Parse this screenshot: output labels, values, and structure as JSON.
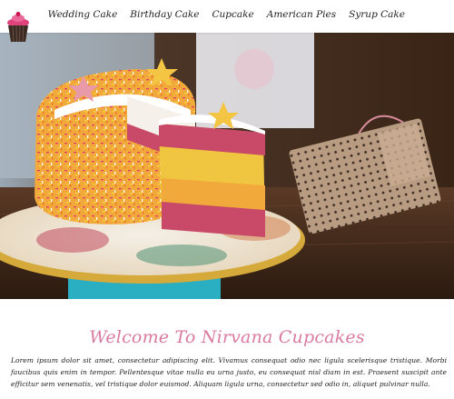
{
  "nav": {
    "items": [
      {
        "label": "Wedding Cake"
      },
      {
        "label": "Birthday Cake"
      },
      {
        "label": "Cupcake"
      },
      {
        "label": "American Pies"
      },
      {
        "label": "Syrup Cake"
      }
    ]
  },
  "brand": {
    "logo_icon": "cupcake-icon",
    "accent_color": "#d97aa0"
  },
  "hero": {
    "image": "cake-on-stand-photo"
  },
  "welcome": {
    "title": "Welcome To Nirvana Cupcakes",
    "body": "Lorem ipsum dolor sit amet, consectetur adipiscing elit. Vivamus consequat odio nec ligula scelerisque tristique. Morbi faucibus quis enim in tempor. Pellentesque vitae nulla eu urna justo, eu consequat nisl diam in est. Praesent suscipit ante efficitur sem venenatis, vel tristique dolor euismod. Aliquam ligula urna, consectetur sed odio in, aliquet pulvinar nulla."
  }
}
